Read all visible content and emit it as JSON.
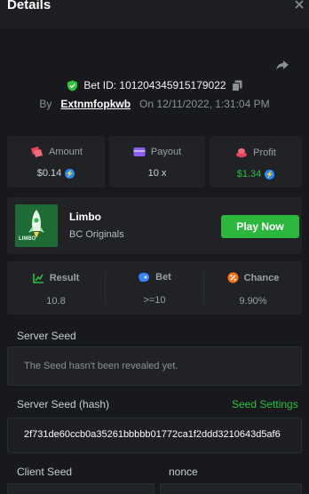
{
  "header": {
    "title": "Details"
  },
  "bet": {
    "id_label": "Bet ID: 101204345915179022",
    "by_label": "By",
    "user": "Extnmfopkwb",
    "on_label": "On",
    "date": "12/11/2022, 1:31:04 PM"
  },
  "stats": {
    "amount": {
      "label": "Amount",
      "value": "$0.14"
    },
    "payout": {
      "label": "Payout",
      "value": "10 x"
    },
    "profit": {
      "label": "Profit",
      "value": "$1.34"
    }
  },
  "game": {
    "name": "Limbo",
    "provider": "BC Originals",
    "thumb_text": "LIMBO",
    "play_label": "Play Now"
  },
  "details": {
    "result": {
      "label": "Result",
      "value": "10.8"
    },
    "bet": {
      "label": "Bet",
      "value": ">=10"
    },
    "chance": {
      "label": "Chance",
      "value": "9.90%"
    }
  },
  "seed": {
    "server_label": "Server Seed",
    "server_value": "The Seed hasn't been revealed yet.",
    "hash_label": "Server Seed (hash)",
    "settings_label": "Seed Settings",
    "hash_value": "2f731de60ccb0a35261bbbbb01772ca1f2ddd3210643d5af6",
    "client_label": "Client Seed",
    "nonce_label": "nonce"
  },
  "colors": {
    "accent_green": "#2cb83f",
    "coin_blue": "#1f8bff",
    "panel": "#202226"
  }
}
